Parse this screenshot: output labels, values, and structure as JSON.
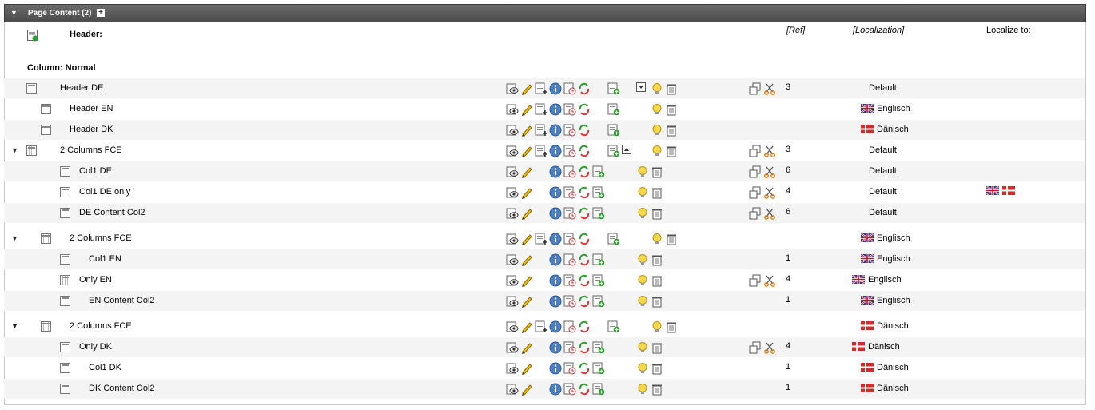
{
  "panel": {
    "title": "Page Content (2)",
    "expand_icon": "plus-icon"
  },
  "headers": {
    "header": "Header:",
    "ref": "[Ref]",
    "localization": "[Localization]",
    "localize_to": "Localize to:"
  },
  "column_label": "Column: Normal",
  "rows": [
    {
      "label": "Header DE",
      "ref": "3",
      "loc": "Default",
      "flag": ""
    },
    {
      "label": "Header EN",
      "ref": "",
      "loc": "Englisch",
      "flag": "uk"
    },
    {
      "label": "Header DK",
      "ref": "",
      "loc": "Dänisch",
      "flag": "dk"
    },
    {
      "label": "2 Columns FCE",
      "ref": "3",
      "loc": "Default",
      "flag": ""
    },
    {
      "label": "Col1 DE",
      "ref": "6",
      "loc": "Default",
      "flag": ""
    },
    {
      "label": "Col1 DE only",
      "ref": "4",
      "loc": "Default",
      "flag": ""
    },
    {
      "label": "DE Content Col2",
      "ref": "6",
      "loc": "Default",
      "flag": ""
    },
    {
      "label": "2 Columns FCE",
      "ref": "",
      "loc": "Englisch",
      "flag": "uk"
    },
    {
      "label": "Col1 EN",
      "ref": "1",
      "loc": "Englisch",
      "flag": "uk"
    },
    {
      "label": "Only EN",
      "ref": "4",
      "loc": "Englisch",
      "flag": "uk"
    },
    {
      "label": "EN Content Col2",
      "ref": "1",
      "loc": "Englisch",
      "flag": "uk"
    },
    {
      "label": "2 Columns FCE",
      "ref": "",
      "loc": "Dänisch",
      "flag": "dk"
    },
    {
      "label": "Only DK",
      "ref": "4",
      "loc": "Dänisch",
      "flag": "dk"
    },
    {
      "label": "Col1 DK",
      "ref": "1",
      "loc": "Dänisch",
      "flag": "dk"
    },
    {
      "label": "DK Content Col2",
      "ref": "1",
      "loc": "Dänisch",
      "flag": "dk"
    }
  ],
  "colors": {
    "titlebar": "#555555",
    "row_alt": "#f4f4f4",
    "info_blue": "#4a7fc1",
    "refresh_green": "#2e9b2e",
    "refresh_red": "#d23a3a",
    "pencil_yellow": "#f0c020",
    "dk_red": "#d22b2b",
    "uk_blue": "#233f8f"
  }
}
